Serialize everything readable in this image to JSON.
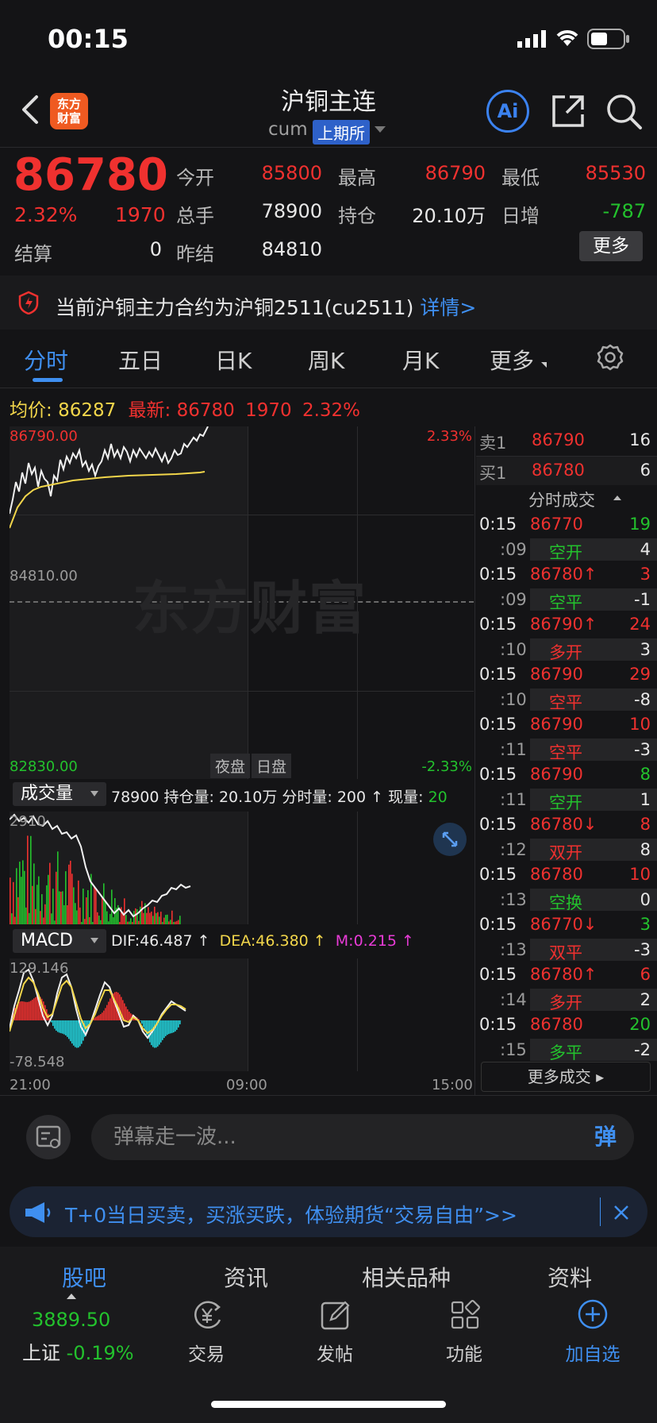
{
  "status_bar": {
    "time": "00:15"
  },
  "header": {
    "logo_text": "东方\n财富",
    "title": "沪铜主连",
    "symbol": "cum",
    "exchange": "上期所",
    "ai_label": "Ai"
  },
  "quote": {
    "last_price": "86780",
    "change_pct": "2.32%",
    "change": "1970",
    "settle_label": "结算",
    "settle": "0",
    "open_label": "今开",
    "open": "85800",
    "volume_label": "总手",
    "volume": "78900",
    "prev_settle_label": "昨结",
    "prev_settle": "84810",
    "high_label": "最高",
    "high": "86790",
    "oi_label": "持仓",
    "oi": "20.10万",
    "low_label": "最低",
    "low": "85530",
    "daily_inc_label": "日增",
    "daily_inc": "-787",
    "more_label": "更多"
  },
  "notice": {
    "text": "当前沪铜主力合约为沪铜2511(cu2511)",
    "link": "详情>"
  },
  "tabs": [
    "分时",
    "五日",
    "日K",
    "周K",
    "月K",
    "更多"
  ],
  "chart": {
    "avg_label": "均价:",
    "avg_value": "86287",
    "latest_label": "最新:",
    "latest_value": "86780",
    "latest_change": "1970",
    "latest_pct": "2.32%",
    "y_top": "86790.00",
    "y_mid": "84810.00",
    "y_bot": "82830.00",
    "pct_top": "2.33%",
    "pct_bot": "-2.33%",
    "session_night": "夜盘",
    "session_day": "日盘",
    "watermark": "东方财富",
    "time_start": "21:00",
    "time_mid": "09:00",
    "time_end": "15:00"
  },
  "volume_panel": {
    "selector": "成交量",
    "info_volume": "78900",
    "info_oi": "持仓量: 20.10万",
    "info_min": "分时量: 200 ↑",
    "info_now_label": "现量:",
    "info_now": "20",
    "y_top": "2910"
  },
  "macd_panel": {
    "selector": "MACD",
    "dif": "DIF:46.487 ↑",
    "dea": "DEA:46.380 ↑",
    "m": "M:0.215 ↑",
    "y_top": "129.146",
    "y_bot": "-78.548"
  },
  "order_book": {
    "sell1_label": "卖1",
    "sell1_price": "86790",
    "sell1_vol": "16",
    "buy1_label": "买1",
    "buy1_price": "86780",
    "buy1_vol": "6"
  },
  "ticks_title": "分时成交",
  "ticks": [
    {
      "time": "0:15",
      "price": "86770",
      "arrow": "",
      "vol": "19",
      "sub": ":09",
      "type": "空开",
      "delta": "4",
      "pc": "red",
      "vc": "green",
      "tc": "green"
    },
    {
      "time": "0:15",
      "price": "86780↑",
      "arrow": "",
      "vol": "3",
      "sub": ":09",
      "type": "空平",
      "delta": "-1",
      "pc": "red",
      "vc": "red",
      "tc": "green"
    },
    {
      "time": "0:15",
      "price": "86790↑",
      "arrow": "",
      "vol": "24",
      "sub": ":10",
      "type": "多开",
      "delta": "3",
      "pc": "red",
      "vc": "red",
      "tc": "red"
    },
    {
      "time": "0:15",
      "price": "86790",
      "arrow": "",
      "vol": "29",
      "sub": ":10",
      "type": "空平",
      "delta": "-8",
      "pc": "red",
      "vc": "red",
      "tc": "red"
    },
    {
      "time": "0:15",
      "price": "86790",
      "arrow": "",
      "vol": "10",
      "sub": ":11",
      "type": "空平",
      "delta": "-3",
      "pc": "red",
      "vc": "red",
      "tc": "red"
    },
    {
      "time": "0:15",
      "price": "86790",
      "arrow": "",
      "vol": "8",
      "sub": ":11",
      "type": "空开",
      "delta": "1",
      "pc": "red",
      "vc": "green",
      "tc": "green"
    },
    {
      "time": "0:15",
      "price": "86780↓",
      "arrow": "",
      "vol": "8",
      "sub": ":12",
      "type": "双开",
      "delta": "8",
      "pc": "red",
      "vc": "red",
      "tc": "red"
    },
    {
      "time": "0:15",
      "price": "86780",
      "arrow": "",
      "vol": "10",
      "sub": ":13",
      "type": "空换",
      "delta": "0",
      "pc": "red",
      "vc": "red",
      "tc": "green"
    },
    {
      "time": "0:15",
      "price": "86770↓",
      "arrow": "",
      "vol": "3",
      "sub": ":13",
      "type": "双平",
      "delta": "-3",
      "pc": "red",
      "vc": "green",
      "tc": "red"
    },
    {
      "time": "0:15",
      "price": "86780↑",
      "arrow": "",
      "vol": "6",
      "sub": ":14",
      "type": "多开",
      "delta": "2",
      "pc": "red",
      "vc": "red",
      "tc": "red"
    },
    {
      "time": "0:15",
      "price": "86780",
      "arrow": "",
      "vol": "20",
      "sub": ":15",
      "type": "多平",
      "delta": "-2",
      "pc": "red",
      "vc": "green",
      "tc": "green"
    }
  ],
  "ticks_more": "更多成交",
  "danmu": {
    "placeholder": "弹幕走一波...",
    "button": "弹"
  },
  "promo": {
    "text": "T+0当日买卖，买涨买跌，体验期货“交易自由”>>"
  },
  "sub_tabs": [
    "股吧",
    "资讯",
    "相关品种",
    "资料"
  ],
  "bottom_nav": {
    "index_value": "3889.50",
    "index_name": "上证",
    "index_change": "-0.19%",
    "items": [
      "交易",
      "发帖",
      "功能",
      "加自选"
    ]
  },
  "colors": {
    "up": "#f0312f",
    "down": "#23c22d",
    "accent": "#3f8ff0",
    "avg": "#f2d64b"
  }
}
